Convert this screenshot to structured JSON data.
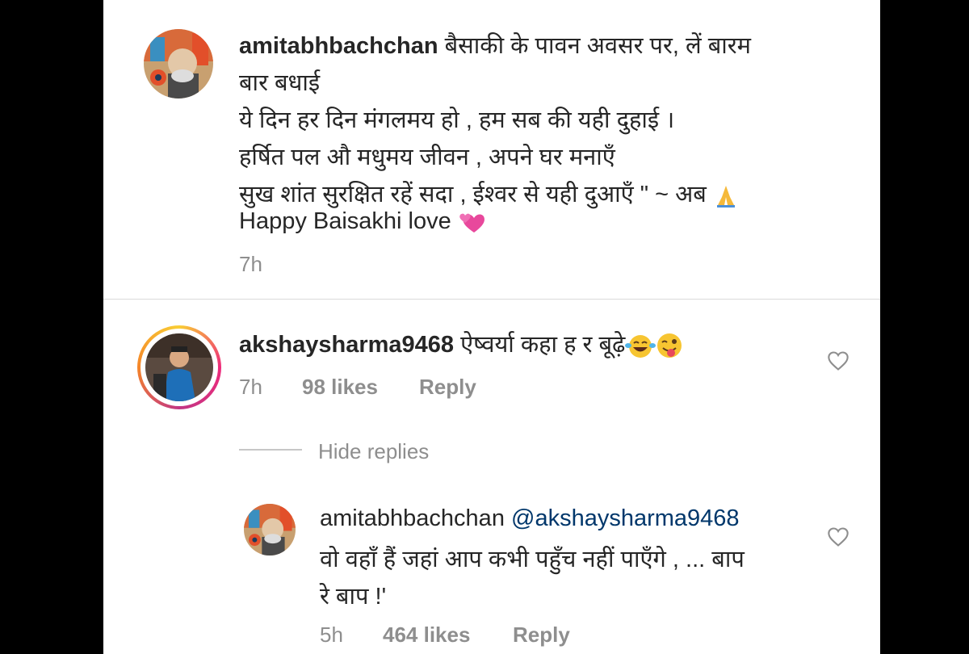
{
  "post": {
    "username": "amitabhbachchan",
    "caption_lines": [
      "बैसाकी  के  पावन  अवसर पर,  लें बारम",
      "बार बधाई",
      "ये दिन हर दिन मंगलमय हो , हम सब की यही दुहाई ।",
      "हर्षित पल औ मधुमय जीवन , अपने घर मनाएँ",
      "सुख शांत सुरक्षित रहें सदा , ईश्वर से यही दुआएँ \" ~ अब",
      "Happy Baisakhi love"
    ],
    "time": "7h"
  },
  "comment": {
    "username": "akshaysharma9468",
    "text": "ऐष्वर्या कहा ह र बूढ़े",
    "time": "7h",
    "likes": "98 likes",
    "reply_label": "Reply",
    "hide_replies_label": "Hide replies"
  },
  "reply": {
    "username": "amitabhbachchan",
    "mention": "@akshaysharma9468",
    "text_lines": [
      "वो वहाँ हैं जहां आप कभी पहुँच नहीं पाएँगे , ... बाप",
      "रे बाप !'"
    ],
    "time": "5h",
    "likes": "464 likes",
    "reply_label": "Reply"
  },
  "icons": {
    "like": "heart-outline-icon",
    "prayer": "folded-hands-icon",
    "hearts": "two-hearts-icon",
    "laugh": "tears-of-joy-icon",
    "wink": "winking-tongue-icon"
  },
  "colors": {
    "text": "#262626",
    "secondary": "#8e8e8e",
    "mention": "#00376b",
    "divider": "#dbdbdb"
  }
}
